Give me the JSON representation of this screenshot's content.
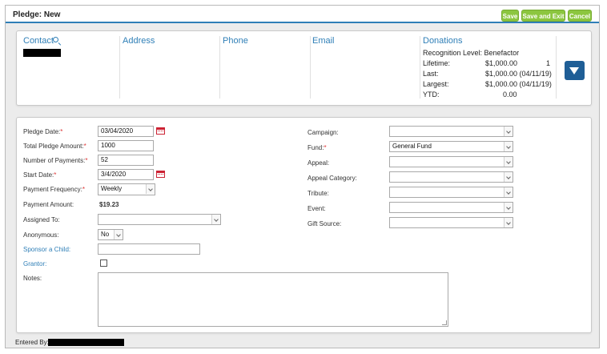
{
  "header": {
    "title": "Pledge: New",
    "buttons": {
      "save": "Save",
      "save_exit": "Save and Exit",
      "cancel": "Cancel"
    },
    "button_color": "#8cc63f",
    "accent_color": "#2f7fb7"
  },
  "summary": {
    "contact_label": "Contact",
    "address_label": "Address",
    "phone_label": "Phone",
    "email_label": "Email",
    "donations_label": "Donations",
    "recognition": "Recognition Level: Benefactor",
    "lifetime_label": "Lifetime:",
    "lifetime_value": "$1,000.00",
    "lifetime_count": "1",
    "last_label": "Last:",
    "last_value": "$1,000.00 (04/11/19)",
    "largest_label": "Largest:",
    "largest_value": "$1,000.00 (04/11/19)",
    "ytd_label": "YTD:",
    "ytd_value": "0.00"
  },
  "form": {
    "pledge_date_label": "Pledge Date:",
    "pledge_date_value": "03/04/2020",
    "total_amount_label": "Total Pledge Amount:",
    "total_amount_value": "1000",
    "num_payments_label": "Number of Payments:",
    "num_payments_value": "52",
    "start_date_label": "Start Date:",
    "start_date_value": "3/4/2020",
    "frequency_label": "Payment Frequency:",
    "frequency_value": "Weekly",
    "payment_amount_label": "Payment Amount:",
    "payment_amount_value": "$19.23",
    "assigned_to_label": "Assigned To:",
    "assigned_to_value": "",
    "anonymous_label": "Anonymous:",
    "anonymous_value": "No",
    "sponsor_label": "Sponsor a Child:",
    "sponsor_value": "",
    "grantor_label": "Grantor:",
    "notes_label": "Notes:",
    "notes_value": "",
    "campaign_label": "Campaign:",
    "campaign_value": "",
    "fund_label": "Fund:",
    "fund_value": "General Fund",
    "appeal_label": "Appeal:",
    "appeal_value": "",
    "appeal_category_label": "Appeal Category:",
    "appeal_category_value": "",
    "tribute_label": "Tribute:",
    "tribute_value": "",
    "event_label": "Event:",
    "event_value": "",
    "gift_source_label": "Gift Source:",
    "gift_source_value": "",
    "required_mark": "*"
  },
  "footer": {
    "entered_by_label": "Entered By:"
  }
}
